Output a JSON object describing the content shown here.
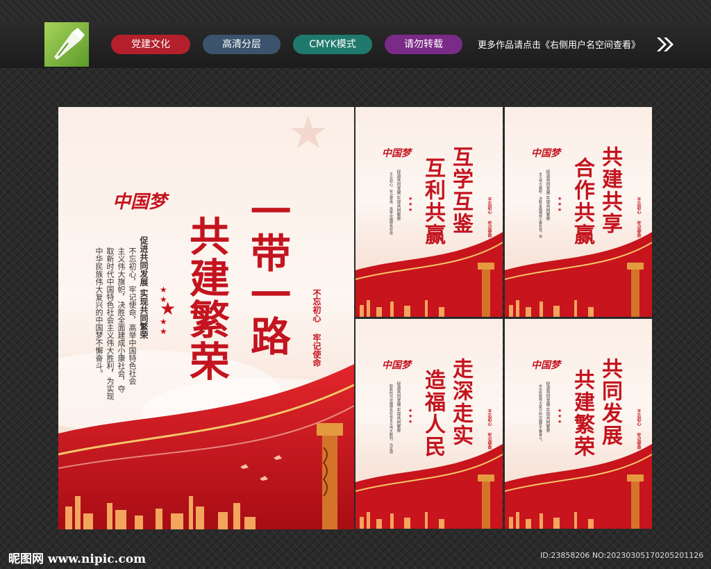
{
  "tags": {
    "party": "党建文化",
    "layers": "高清分层",
    "cmyk": "CMYK模式",
    "no_repost": "请勿转载"
  },
  "more_works": "更多作品请点击《右侧用户名空间查看》",
  "main_poster": {
    "logo_text": "中国梦",
    "title_line1": "一带一路",
    "title_line2": "共建繁荣",
    "subtitle": "促进共同发展 实现共同繁荣",
    "body": [
      "不忘初心，牢记使命，高举中国特色社会",
      "主义伟大旗帜，决胜全面建成小康社会，夺",
      "取新时代中国特色社会主义伟大胜利，为实现",
      "中华民族伟大复兴的中国梦不懈奋斗。"
    ],
    "seal_1": "不忘初心",
    "seal_2": "牢记使命"
  },
  "small_posters": [
    {
      "line1": "互学互鉴",
      "line2": "互利共赢"
    },
    {
      "line1": "共建共享",
      "line2": "合作共赢"
    },
    {
      "line1": "走深走实",
      "line2": "造福人民"
    },
    {
      "line1": "共同发展",
      "line2": "共建繁荣"
    }
  ],
  "small_common": {
    "subtitle": "促进共同发展 实现共同繁荣",
    "seal_1": "不忘初心",
    "seal_2": "牢记使命",
    "body": [
      "不忘初心，牢记使命，高举中国特色社会",
      "主义伟大旗帜，决胜全面建成小康社会，夺",
      "取新时代中国特色社会主义伟大胜利，为实现",
      "中华民族伟大复兴的中国梦不懈奋斗。"
    ]
  },
  "watermark": {
    "site": "昵图网 www.nipic.com",
    "id": "ID:23858206 NO:20230305170205201126"
  },
  "colors": {
    "party_red": "#c3141f",
    "tag_red": "#b3202b",
    "tag_blue": "#3c536d",
    "tag_teal": "#1f7a6d",
    "tag_purple": "#7a2a87"
  }
}
